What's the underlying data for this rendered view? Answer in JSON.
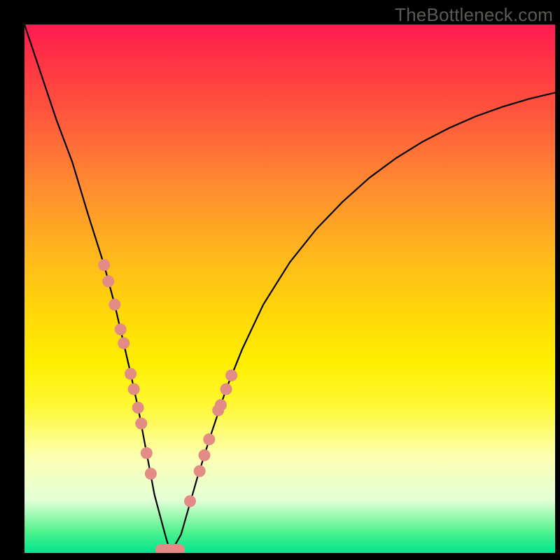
{
  "watermark": "TheBottleneck.com",
  "colors": {
    "frame": "#000000",
    "marker": "#e38b85",
    "curve": "#000000",
    "gradient_top": "#ff1a53",
    "gradient_bottom": "#00e48e"
  },
  "chart_data": {
    "type": "line",
    "title": "",
    "xlabel": "",
    "ylabel": "",
    "xlim": [
      0,
      100
    ],
    "ylim": [
      0,
      100
    ],
    "x": [
      0,
      3,
      6,
      9,
      12,
      15,
      17,
      18.5,
      20,
      21.5,
      23,
      24.5,
      26.5,
      27.5,
      29.5,
      32.5,
      35,
      38,
      41,
      45,
      50,
      55,
      60,
      65,
      70,
      75,
      80,
      85,
      90,
      95,
      100
    ],
    "y": [
      100,
      91,
      82,
      74,
      64,
      54.5,
      47,
      40.5,
      34,
      27,
      19,
      11,
      3.5,
      0,
      3.5,
      14,
      22,
      31,
      38.5,
      47,
      55,
      61.3,
      66.5,
      71,
      74.7,
      77.8,
      80.4,
      82.6,
      84.4,
      85.9,
      87.1
    ],
    "markers_left": [
      {
        "x": 15,
        "y": 54.5
      },
      {
        "x": 15.8,
        "y": 51.4
      },
      {
        "x": 17,
        "y": 47
      },
      {
        "x": 18.1,
        "y": 42.3
      },
      {
        "x": 18.7,
        "y": 39.7
      },
      {
        "x": 20,
        "y": 33.9
      },
      {
        "x": 20.6,
        "y": 31
      },
      {
        "x": 21.4,
        "y": 27.5
      },
      {
        "x": 22,
        "y": 24.5
      },
      {
        "x": 23,
        "y": 18.9
      },
      {
        "x": 23.8,
        "y": 15
      }
    ],
    "markers_right": [
      {
        "x": 31.2,
        "y": 9.8
      },
      {
        "x": 33,
        "y": 15.5
      },
      {
        "x": 33.9,
        "y": 18.5
      },
      {
        "x": 34.8,
        "y": 21.5
      },
      {
        "x": 36.5,
        "y": 27
      },
      {
        "x": 37,
        "y": 28
      },
      {
        "x": 38,
        "y": 31
      },
      {
        "x": 39,
        "y": 33.6
      }
    ],
    "markers_bottom": [
      {
        "x": 25.8,
        "y": 0.6
      },
      {
        "x": 27.9,
        "y": 0.6
      },
      {
        "x": 29.1,
        "y": 0.6
      }
    ]
  }
}
